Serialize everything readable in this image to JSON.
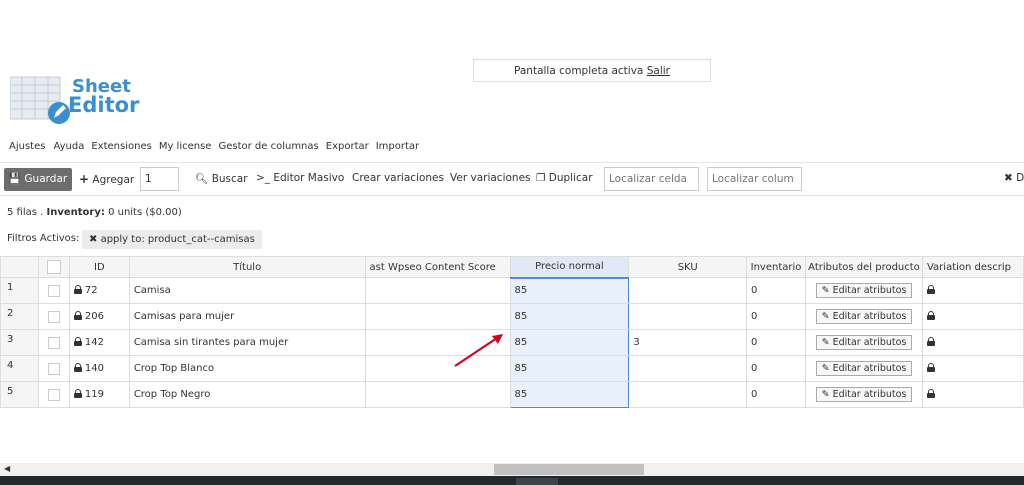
{
  "fullscreen": {
    "text": "Pantalla completa activa",
    "exit_link": "Salir"
  },
  "logo": {
    "line1": "Sheet",
    "line2": "Editor"
  },
  "menu": [
    "Ajustes",
    "Ayuda",
    "Extensiones",
    "My license",
    "Gestor de columnas",
    "Exportar",
    "Importar"
  ],
  "toolbar": {
    "save": "Guardar",
    "add": "Agregar",
    "add_count": "1",
    "search": "Buscar",
    "bulk_edit": ">_ Editor Masivo",
    "create_variations": "Crear variaciones",
    "view_variations": "Ver variaciones",
    "duplicate": "Duplicar",
    "locate_cell_placeholder": "Localizar celda",
    "locate_column_placeholder": "Localizar colum",
    "right_label": "D"
  },
  "summary": {
    "rows": "5 filas .",
    "inventory_label": "Inventory:",
    "inventory_value": "0 units ($0.00)"
  },
  "filters": {
    "label": "Filtros Activos:",
    "chip": "apply to: product_cat--camisas"
  },
  "columns": [
    "ID",
    "Título",
    "ast Wpseo Content Score",
    "Precio normal",
    "SKU",
    "Inventario",
    "Atributos del producto",
    "Variation descrip"
  ],
  "rows": [
    {
      "num": "1",
      "id": "72",
      "title": "Camisa",
      "seo": "",
      "price": "85",
      "sku": "",
      "inventory": "0",
      "attr_btn": "Editar atributos"
    },
    {
      "num": "2",
      "id": "206",
      "title": "Camisas para mujer",
      "seo": "",
      "price": "85",
      "sku": "",
      "inventory": "0",
      "attr_btn": "Editar atributos"
    },
    {
      "num": "3",
      "id": "142",
      "title": "Camisa sin tirantes para mujer",
      "seo": "",
      "price": "85",
      "sku": "3",
      "inventory": "0",
      "attr_btn": "Editar atributos"
    },
    {
      "num": "4",
      "id": "140",
      "title": "Crop Top Blanco",
      "seo": "",
      "price": "85",
      "sku": "",
      "inventory": "0",
      "attr_btn": "Editar atributos"
    },
    {
      "num": "5",
      "id": "119",
      "title": "Crop Top Negro",
      "seo": "",
      "price": "85",
      "sku": "",
      "inventory": "0",
      "attr_btn": "Editar atributos"
    }
  ],
  "colors": {
    "accent": "#3b8fd0",
    "selection": "#4a89dc",
    "arrow": "#d0021b",
    "save_btn": "#6d6d6d"
  }
}
